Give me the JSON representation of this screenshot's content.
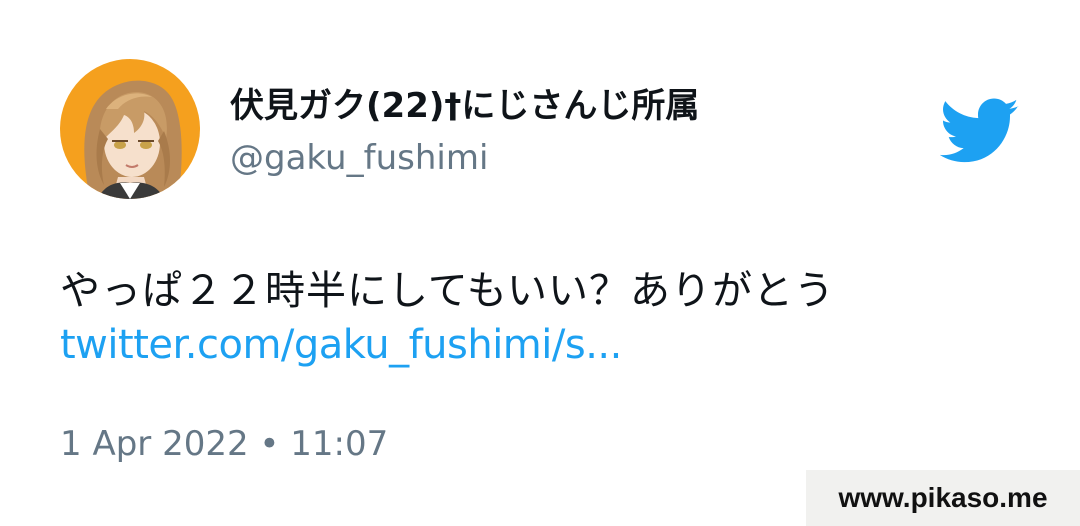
{
  "user": {
    "display_name": "伏見ガク(22)†にじさんじ所属",
    "handle": "@gaku_fushimi",
    "avatar_icon": "avatar-icon"
  },
  "brand": {
    "logo_icon": "twitter-bird-icon",
    "color": "#1DA1F2"
  },
  "tweet": {
    "text": "やっぱ２２時半にしてもいい？ありがとう",
    "link": "twitter.com/gaku_fushimi/s...",
    "timestamp": "1 Apr 2022 • 11:07"
  },
  "watermark": {
    "text": "www.pikaso.me"
  },
  "colors": {
    "text_primary": "#0F1419",
    "text_secondary": "#657786",
    "link": "#1DA1F2",
    "avatar_bg": "#F5A623"
  }
}
